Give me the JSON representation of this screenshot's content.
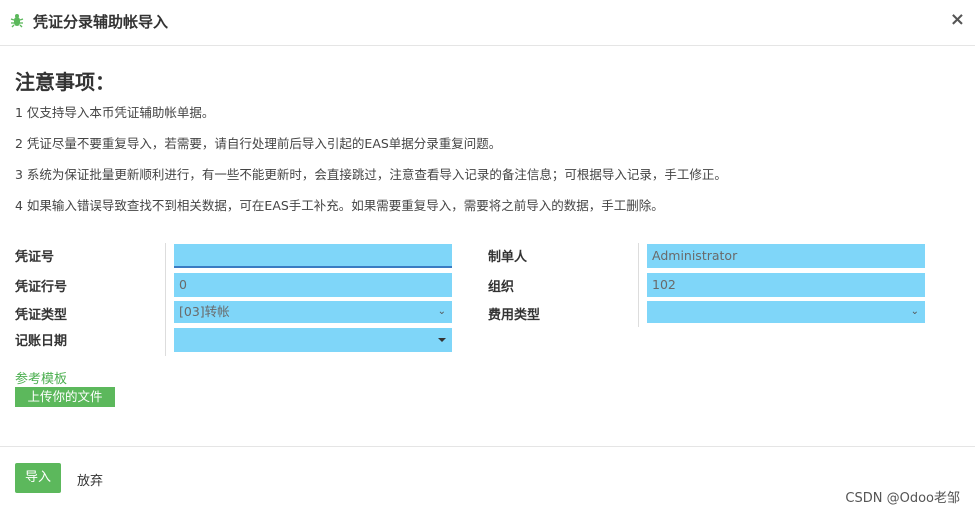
{
  "dialog": {
    "title": "凭证分录辅助帐导入",
    "close_label": "×"
  },
  "notice": {
    "title": "注意事项：",
    "items": [
      "1 仅支持导入本币凭证辅助帐单据。",
      "2 凭证尽量不要重复导入，若需要，请自行处理前后导入引起的EAS单据分录重复问题。",
      "3 系统为保证批量更新顺利进行，有一些不能更新时，会直接跳过，注意查看导入记录的备注信息；可根据导入记录，手工修正。",
      "4 如果输入错误导致查找不到相关数据，可在EAS手工补充。如果需要重复导入，需要将之前导入的数据，手工删除。"
    ]
  },
  "form": {
    "voucher_no": {
      "label": "凭证号",
      "value": ""
    },
    "voucher_line": {
      "label": "凭证行号",
      "value": "0"
    },
    "voucher_type": {
      "label": "凭证类型",
      "value": "[03]转帐"
    },
    "posting_date": {
      "label": "记账日期",
      "value": ""
    },
    "creator": {
      "label": "制单人",
      "value": "Administrator"
    },
    "organization": {
      "label": "组织",
      "value": "102"
    },
    "expense_type": {
      "label": "费用类型",
      "value": ""
    }
  },
  "template_link": "参考模板",
  "upload_button": "上传你的文件",
  "footer": {
    "import_label": "导入",
    "discard_label": "放弃"
  },
  "watermark": "CSDN @Odoo老邹",
  "colors": {
    "field_bg": "#7fd6f9",
    "primary_green": "#5cb85c",
    "link_green": "#4caf50"
  },
  "icons": {
    "title_icon": "bug-icon",
    "close": "close-icon"
  }
}
